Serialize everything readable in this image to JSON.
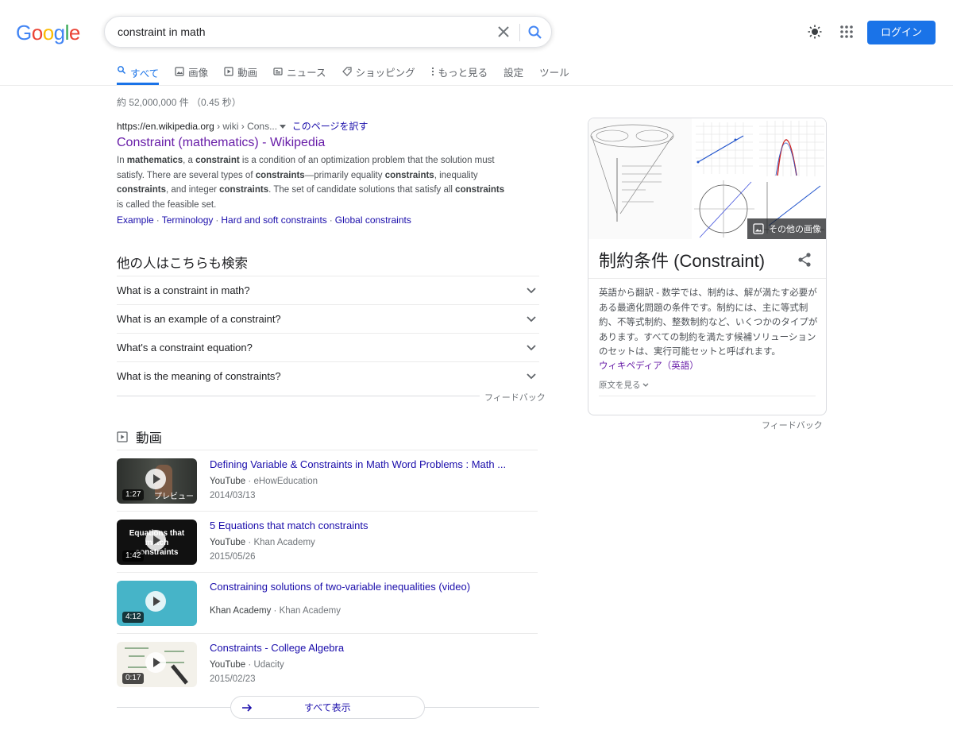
{
  "logo": {
    "letters": [
      "G",
      "o",
      "o",
      "g",
      "l",
      "e"
    ],
    "colors": [
      "#4285f4",
      "#ea4335",
      "#fbbc05",
      "#4285f4",
      "#34a853",
      "#ea4335"
    ]
  },
  "search": {
    "query": "constraint in math",
    "clear_icon": "close-icon",
    "search_icon": "search-icon"
  },
  "header": {
    "theme_icon": "brightness-icon",
    "apps_icon": "apps-grid-icon",
    "login_label": "ログイン"
  },
  "tabs": [
    {
      "label": "すべて",
      "icon": "search-icon",
      "active": true
    },
    {
      "label": "画像",
      "icon": "image-icon"
    },
    {
      "label": "動画",
      "icon": "video-icon"
    },
    {
      "label": "ニュース",
      "icon": "news-icon"
    },
    {
      "label": "ショッピング",
      "icon": "tag-icon"
    },
    {
      "label": "もっと見る",
      "icon": "more-icon"
    },
    {
      "label": "設定"
    },
    {
      "label": "ツール"
    }
  ],
  "stats": "約 52,000,000 件 （0.45 秒）",
  "result": {
    "domain": "https://en.wikipedia.org",
    "path": " › wiki › Cons... ",
    "translate": "このページを訳す",
    "title": "Constraint (mathematics) - Wikipedia",
    "snippet_html": "In <b>mathematics</b>, a <b>constraint</b> is a condition of an optimization problem that the solution must satisfy. There are several types of <b>constraints</b>—primarily equality <b>constraints</b>, inequality <b>constraints</b>, and integer <b>constraints</b>. The set of candidate solutions that satisfy all <b>constraints</b> is called the feasible set.",
    "sitelinks": [
      "Example",
      "Terminology",
      "Hard and soft constraints",
      "Global constraints"
    ]
  },
  "paa": {
    "heading": "他の人はこちらも検索",
    "questions": [
      "What is a constraint in math?",
      "What is an example of a constraint?",
      "What's a constraint equation?",
      "What is the meaning of constraints?"
    ],
    "feedback": "フィードバック"
  },
  "videos": {
    "heading": "動画",
    "items": [
      {
        "title": "Defining Variable & Constraints in Math Word Problems : Math ...",
        "source": "YouTube",
        "channel": "eHowEducation",
        "date": "2014/03/13",
        "duration": "1:27",
        "badge": "プレビュー",
        "thumb_color": "#3a3d3a"
      },
      {
        "title": "5 Equations that match constraints",
        "source": "YouTube",
        "channel": "Khan Academy",
        "date": "2015/05/26",
        "duration": "1:42",
        "overlay": "Equations that match constraints",
        "thumb_color": "#111111"
      },
      {
        "title": "Constraining solutions of two-variable inequalities (video)",
        "source": "Khan Academy",
        "channel": "Khan Academy",
        "date": "",
        "duration": "4:12",
        "thumb_color": "#46b4c8"
      },
      {
        "title": "Constraints - College Algebra",
        "source": "YouTube",
        "channel": "Udacity",
        "date": "2015/02/23",
        "duration": "0:17",
        "thumb_color": "#f3f1ea"
      }
    ],
    "show_all": "すべて表示"
  },
  "knowledge_panel": {
    "title": "制約条件 (Constraint)",
    "more_images": "その他の画像",
    "description": "英語から翻訳 - 数学では、制約は、解が満たす必要がある最適化問題の条件です。制約には、主に等式制約、不等式制約、整数制約など、いくつかのタイプがあります。すべての制約を満たす候補ソリューションのセットは、実行可能セットと呼ばれます。",
    "source": "ウィキペディア（英語）",
    "original": "原文を見る",
    "feedback": "フィードバック"
  }
}
